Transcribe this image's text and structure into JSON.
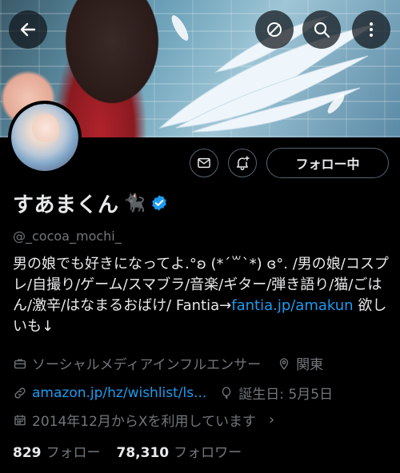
{
  "header": {
    "back_icon": "arrow-left-icon",
    "block_icon": "no-symbol-icon",
    "search_icon": "search-icon",
    "more_icon": "more-vertical-icon"
  },
  "profile": {
    "display_name": "すあまくん",
    "name_emoji": "🐈‍⬛",
    "verified_color": "#1d9bf0",
    "handle": "@_cocoa_mochi_",
    "follow_button_label": "フォロー中",
    "bio": {
      "part1": "男の娘でも好きになってよ.°ʚ (*´꒳`*) ɞ°. /男の娘/コスプレ/自撮り/ゲーム/スマブラ/音楽/ギター/弾き語り/猫/ごはん/激辛/はなまるおばけ/ Fantia→",
      "link": "fantia.jp/amakun",
      "part2": " 欲しいも↓"
    },
    "category": "ソーシャルメディアインフルエンサー",
    "location": "関東",
    "website": "amazon.jp/hz/wishlist/ls...",
    "birthday": "誕生日: 5月5日",
    "joined": "2014年12月からXを利用しています",
    "following_count": "829",
    "following_label": "フォロー",
    "followers_count": "78,310",
    "followers_label": "フォロワー"
  },
  "colors": {
    "background": "#000000",
    "text_primary": "#e7e9ea",
    "text_secondary": "#71767b",
    "link": "#1d9bf0",
    "button_border": "#536471"
  }
}
